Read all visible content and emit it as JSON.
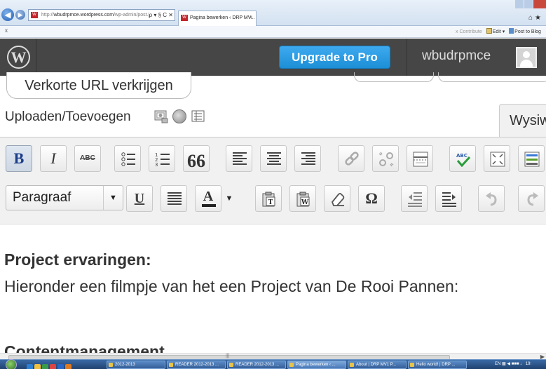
{
  "browser": {
    "address": {
      "prefix": "http://",
      "domain": "wbudrpmce.wordpress.com",
      "path": "/wp-admin/post.j",
      "controls": "ρ ▾ § C ✕"
    },
    "tab": {
      "label": "Pagina bewerken ‹ DRP MV...",
      "close": "✕"
    },
    "command_x": "x",
    "command_bar": {
      "contribute": "Contribute",
      "edit": "Edit",
      "post_to_blog": "Post to Blog"
    }
  },
  "adminbar": {
    "logo": "W",
    "upgrade_label": "Upgrade to Pro",
    "username": "wbudrpmce"
  },
  "editor": {
    "short_url_label": "Verkorte URL verkrijgen",
    "upload_label": "Uploaden/Toevoegen",
    "wysiwyg_tab": "Wysiwyg",
    "format_value": "Paragraaf",
    "toolbar_row1": [
      "B",
      "I",
      "ABC",
      "66"
    ],
    "toolbar_row2": [
      "U",
      "A",
      "Ω"
    ]
  },
  "content": {
    "heading1": "Project ervaringen:",
    "paragraph1": "Hieronder een filmpje van het een Project van De Rooi Pannen:",
    "heading2": "Contentmanagement"
  },
  "taskbar": {
    "items": [
      "2012-2013",
      "READER 2012-2013 ...",
      "READER 2012-2013 ...",
      "Pagina bewerken ‹ ...",
      "About | DRP MV1 P...",
      "Hello world! | DRP ..."
    ],
    "tray": "EN",
    "clock": "19:"
  },
  "colors": {
    "adminbar": "#464646",
    "upgrade": "#2ea2e7",
    "wp_red": "#c1272d"
  }
}
